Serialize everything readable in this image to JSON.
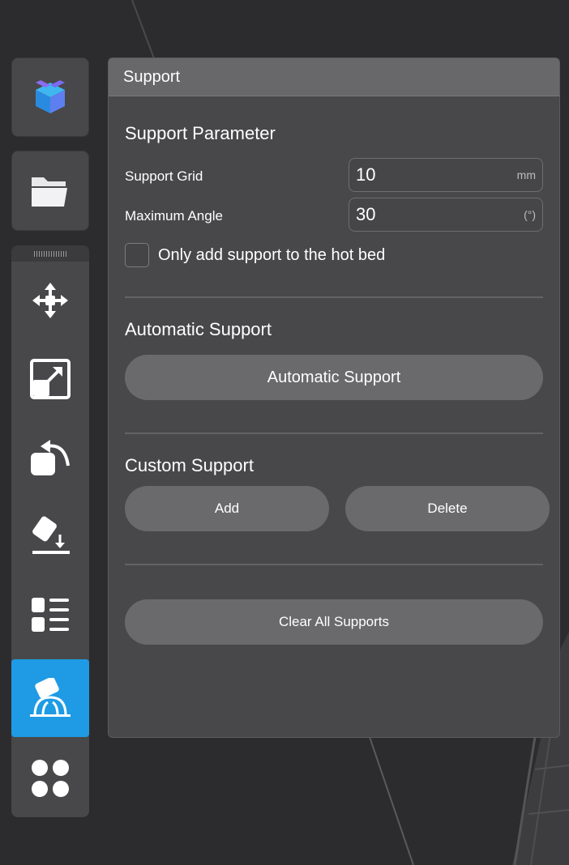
{
  "toolbar": {
    "top_buttons": [
      {
        "icon": "app-logo-icon"
      },
      {
        "icon": "folder-icon"
      }
    ],
    "tools": [
      {
        "name": "move",
        "icon": "move-icon",
        "active": false
      },
      {
        "name": "scale",
        "icon": "scale-icon",
        "active": false
      },
      {
        "name": "rotate",
        "icon": "rotate-icon",
        "active": false
      },
      {
        "name": "lay-flat",
        "icon": "lay-flat-icon",
        "active": false
      },
      {
        "name": "list",
        "icon": "list-icon",
        "active": false
      },
      {
        "name": "support",
        "icon": "support-icon",
        "active": true
      },
      {
        "name": "more",
        "icon": "grid-icon",
        "active": false
      }
    ],
    "active_color": "#1e9be4"
  },
  "panel": {
    "title": "Support",
    "parameter_section": {
      "title": "Support Parameter",
      "grid_label": "Support Grid",
      "grid_value": "10",
      "grid_unit": "mm",
      "angle_label": "Maximum Angle",
      "angle_value": "30",
      "angle_unit": "(°)",
      "hotbed_checkbox_label": "Only add support to the hot bed",
      "hotbed_checked": false
    },
    "automatic_section": {
      "title": "Automatic Support",
      "button_label": "Automatic Support"
    },
    "custom_section": {
      "title": "Custom Support",
      "add_label": "Add",
      "delete_label": "Delete"
    },
    "clear_label": "Clear All Supports"
  }
}
